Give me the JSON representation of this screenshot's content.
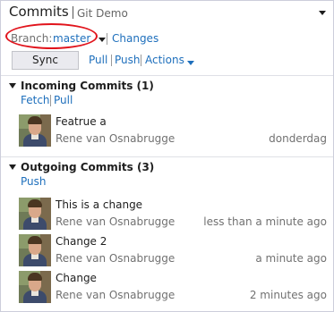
{
  "header": {
    "title": "Commits",
    "repository": "Git Demo"
  },
  "branch": {
    "label": "Branch:",
    "value": "master",
    "changes_link": "Changes"
  },
  "toolbar": {
    "sync_label": "Sync",
    "pull_label": "Pull",
    "push_label": "Push",
    "actions_label": "Actions"
  },
  "colors": {
    "link": "#1e6fbc",
    "highlight": "#e1141c",
    "muted_text": "#717171"
  },
  "incoming": {
    "title": "Incoming Commits (1)",
    "fetch_label": "Fetch",
    "pull_label": "Pull",
    "commits": [
      {
        "message": "Featrue a",
        "author": "Rene van Osnabrugge",
        "time": "donderdag"
      }
    ]
  },
  "outgoing": {
    "title": "Outgoing Commits (3)",
    "push_label": "Push",
    "commits": [
      {
        "message": "This is a change",
        "author": "Rene van Osnabrugge",
        "time": "less than a minute ago"
      },
      {
        "message": "Change 2",
        "author": "Rene van Osnabrugge",
        "time": "a minute ago"
      },
      {
        "message": "Change",
        "author": "Rene van Osnabrugge",
        "time": "2 minutes ago"
      }
    ]
  }
}
